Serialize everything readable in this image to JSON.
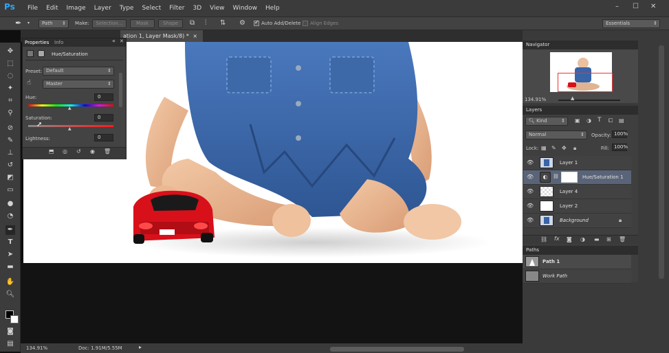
{
  "app": {
    "logo": "Ps"
  },
  "menu": [
    "File",
    "Edit",
    "Image",
    "Layer",
    "Type",
    "Select",
    "Filter",
    "3D",
    "View",
    "Window",
    "Help"
  ],
  "window_controls": [
    "–",
    "☐",
    "✕"
  ],
  "options_bar": {
    "path_mode": "Path",
    "make_label": "Make:",
    "selection_btn": "Selection...",
    "mask_btn": "Mask",
    "shape_btn": "Shape",
    "auto_add_delete": "Auto Add/Delete",
    "align_edges": "Align Edges",
    "workspace": "Essentials"
  },
  "document": {
    "tab_title": "ation 1, Layer Mask/8) *",
    "tab_close": "×",
    "zoom": "134.91%",
    "doc_size": "Doc: 1.91M/5.55M"
  },
  "properties": {
    "tab_properties": "Properties",
    "tab_info": "Info",
    "adjustment_name": "Hue/Saturation",
    "preset_label": "Preset:",
    "preset_value": "Default",
    "channel_value": "Master",
    "hue_label": "Hue:",
    "hue_value": "0",
    "saturation_label": "Saturation:",
    "saturation_value": "0",
    "lightness_label": "Lightness:",
    "lightness_value": "0"
  },
  "navigator": {
    "title": "Navigator",
    "zoom": "134.91%"
  },
  "layers_panel": {
    "title": "Layers",
    "filter": "Kind",
    "blend_mode": "Normal",
    "opacity_label": "Opacity:",
    "opacity_value": "100%",
    "lock_label": "Lock:",
    "fill_label": "Fill:",
    "fill_value": "100%",
    "layers": [
      {
        "name": "Layer 1",
        "thumb": "photo"
      },
      {
        "name": "Hue/Saturation 1",
        "thumb": "adjustment",
        "selected": true
      },
      {
        "name": "Layer 4",
        "thumb": "transparent"
      },
      {
        "name": "Layer 2",
        "thumb": "white"
      },
      {
        "name": "Background",
        "thumb": "photo",
        "locked": true
      }
    ]
  },
  "paths_panel": {
    "title": "Paths",
    "paths": [
      {
        "name": "Path 1"
      },
      {
        "name": "Work Path"
      }
    ]
  },
  "colors": {
    "accent_ps": "#2fa6f5",
    "selected_layer": "#5a6478",
    "denim": "#3a64a8",
    "car_red": "#d8101a"
  }
}
